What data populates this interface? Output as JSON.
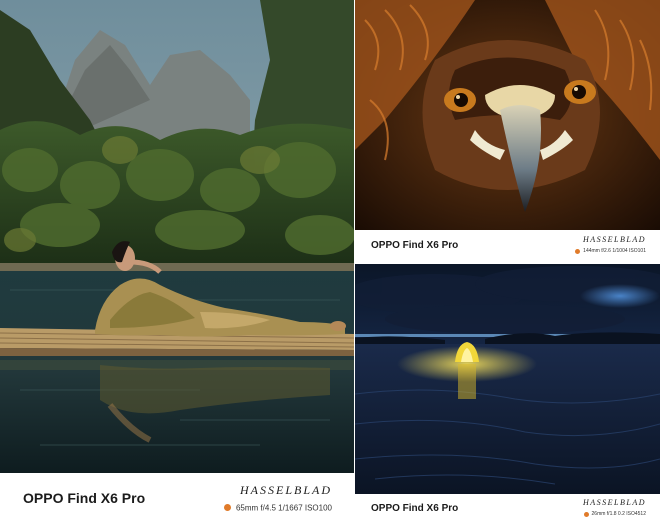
{
  "panels": [
    {
      "id": "river-portrait",
      "device_name": "OPPO Find X6 Pro",
      "brand_mark": "HASSELBLAD",
      "exif": "65mm  f/4.5  1/1667  ISO100",
      "dot_color": "#e07b2a"
    },
    {
      "id": "eagle-closeup",
      "device_name": "OPPO Find X6 Pro",
      "brand_mark": "HASSELBLAD",
      "exif": "144mm f/2.6 1/1004 ISO101",
      "dot_color": "#e07b2a"
    },
    {
      "id": "night-tent",
      "device_name": "OPPO Find X6 Pro",
      "brand_mark": "HASSELBLAD",
      "exif": "26mm f/1.8 0.2 ISO4512",
      "dot_color": "#e07b2a"
    }
  ]
}
